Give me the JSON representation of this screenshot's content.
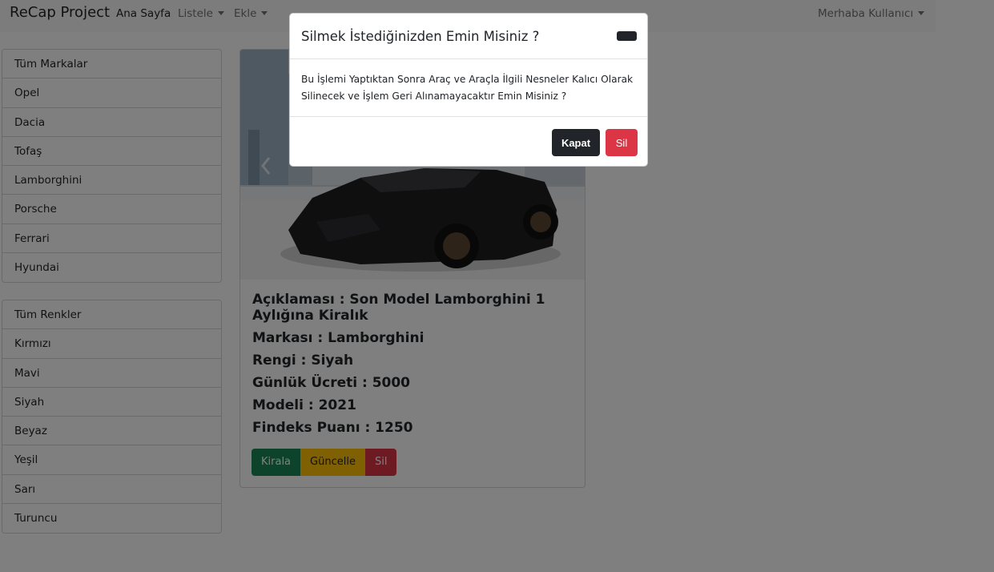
{
  "navbar": {
    "brand": "ReCap Project",
    "home": "Ana Sayfa",
    "list_menu": "Listele",
    "add_menu": "Ekle",
    "user_menu": "Merhaba Kullanıcı"
  },
  "brands": {
    "items": [
      "Tüm Markalar",
      "Opel",
      "Dacia",
      "Tofaş",
      "Lamborghini",
      "Porsche",
      "Ferrari",
      "Hyundai"
    ]
  },
  "colors": {
    "items": [
      "Tüm Renkler",
      "Kırmızı",
      "Mavi",
      "Siyah",
      "Beyaz",
      "Yeşil",
      "Sarı",
      "Turuncu"
    ]
  },
  "car": {
    "description": "Açıklaması : Son Model Lamborghini 1 Aylığına Kiralık",
    "brand": "Markası : Lamborghini",
    "color": "Rengi : Siyah",
    "daily_price": "Günlük Ücreti : 5000",
    "model": "Modeli : 2021",
    "findeks": "Findeks Puanı : 1250",
    "rent_label": "Kirala",
    "update_label": "Güncelle",
    "delete_label": "Sil",
    "image_icon": "car-photo"
  },
  "modal": {
    "title": "Silmek İstediğinizden Emin Misiniz ?",
    "body": "Bu İşlemi Yaptıktan Sonra Araç ve Araçla İlgili Nesneler Kalıcı Olarak Silinecek ve İşlem Geri Alınamayacaktır Emin Misiniz ?",
    "close_label": "Kapat",
    "delete_label": "Sil"
  },
  "theme": {
    "success": "#198754",
    "warning": "#ffc107",
    "danger": "#dc3545",
    "dark": "#212529"
  }
}
